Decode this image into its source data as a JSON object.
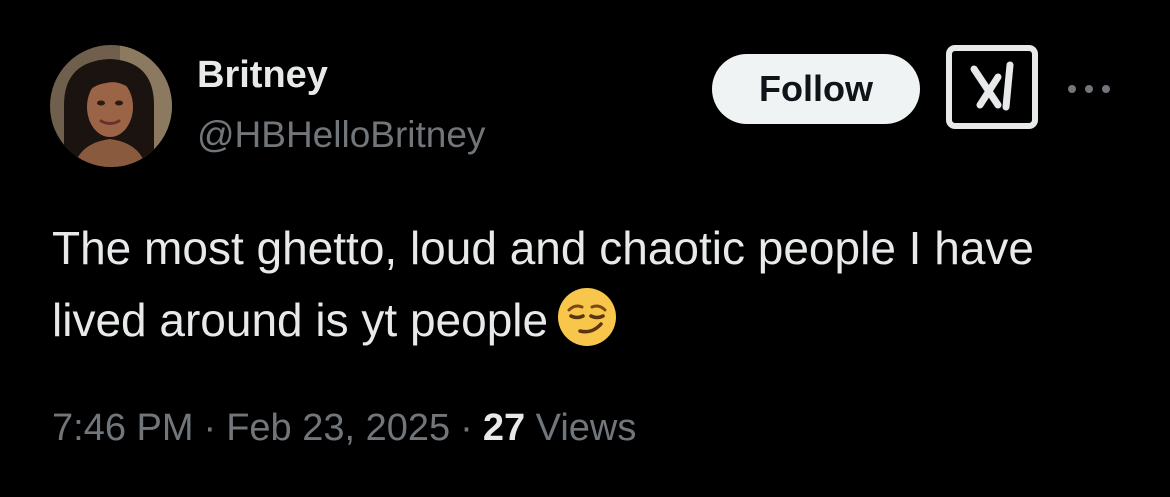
{
  "author": {
    "display_name": "Britney",
    "handle": "@HBHelloBritney",
    "avatar_icon": "profile-photo"
  },
  "actions": {
    "follow_label": "Follow",
    "grok_icon": "grok-icon",
    "more_icon": "more-horizontal-icon"
  },
  "tweet": {
    "text": "The most ghetto, loud and chaotic people I have lived around is yt people",
    "emoji": "smirking-face-emoji"
  },
  "meta": {
    "time": "7:46 PM",
    "separator": "·",
    "date": "Feb 23, 2025",
    "views_count": "27",
    "views_label": "Views"
  },
  "colors": {
    "background": "#000000",
    "primary_text": "#e7e9ea",
    "secondary_text": "#71767b",
    "follow_bg": "#eff3f4",
    "follow_text": "#0f1419"
  }
}
